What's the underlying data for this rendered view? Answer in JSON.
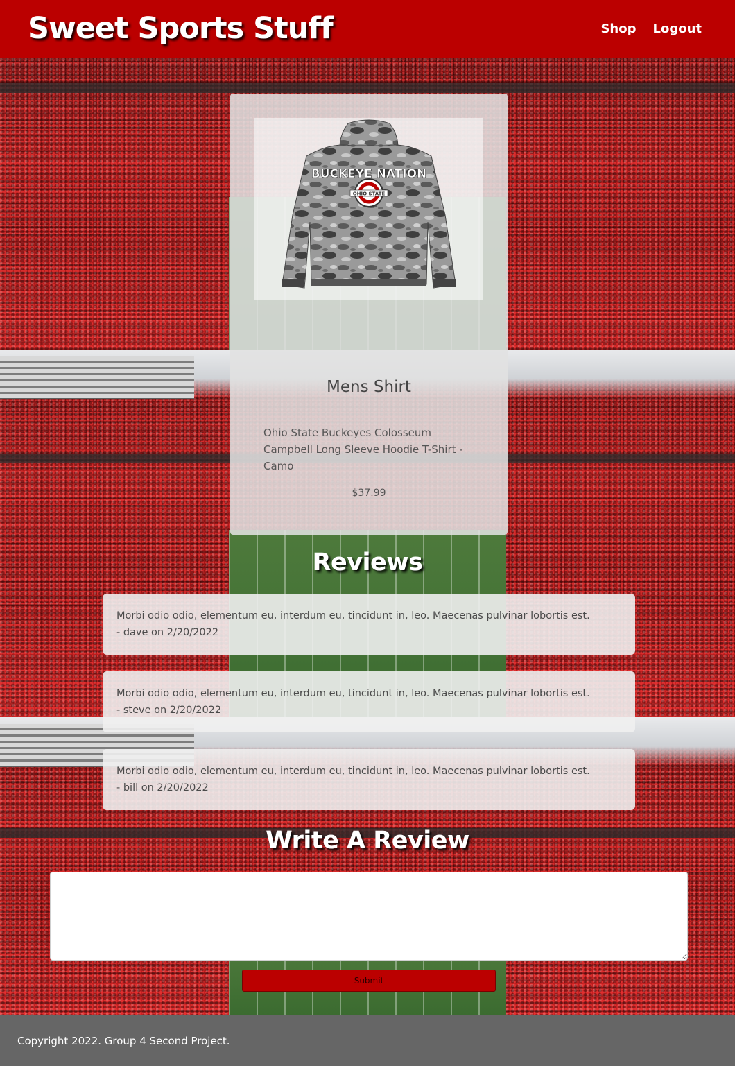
{
  "header": {
    "brand": "Sweet Sports Stuff",
    "nav": [
      {
        "label": "Shop"
      },
      {
        "label": "Logout"
      }
    ]
  },
  "product": {
    "image_alt": "Ohio State Buckeyes camo hoodie",
    "hoodie_print": "BUCKEYE NATION",
    "logo_text": "OHIO STATE",
    "name": "Mens Shirt",
    "description": "Ohio State Buckeyes Colosseum Campbell Long Sleeve Hoodie T-Shirt - Camo",
    "price": "$37.99"
  },
  "reviews_section": {
    "heading": "Reviews",
    "items": [
      {
        "text": "Morbi odio odio, elementum eu, interdum eu, tincidunt in, leo. Maecenas pulvinar lobortis est.",
        "meta": "- dave on 2/20/2022"
      },
      {
        "text": "Morbi odio odio, elementum eu, interdum eu, tincidunt in, leo. Maecenas pulvinar lobortis est.",
        "meta": "- steve on 2/20/2022"
      },
      {
        "text": "Morbi odio odio, elementum eu, interdum eu, tincidunt in, leo. Maecenas pulvinar lobortis est.",
        "meta": "- bill on 2/20/2022"
      }
    ]
  },
  "write_review": {
    "heading": "Write A Review",
    "input_value": "",
    "input_placeholder": "",
    "submit_label": "Submit"
  },
  "footer": {
    "copyright": "Copyright 2022. Group 4 Second Project."
  },
  "colors": {
    "brand_red": "#bb0000",
    "footer_gray": "#666666",
    "card_gray": "#e1e1e1"
  }
}
